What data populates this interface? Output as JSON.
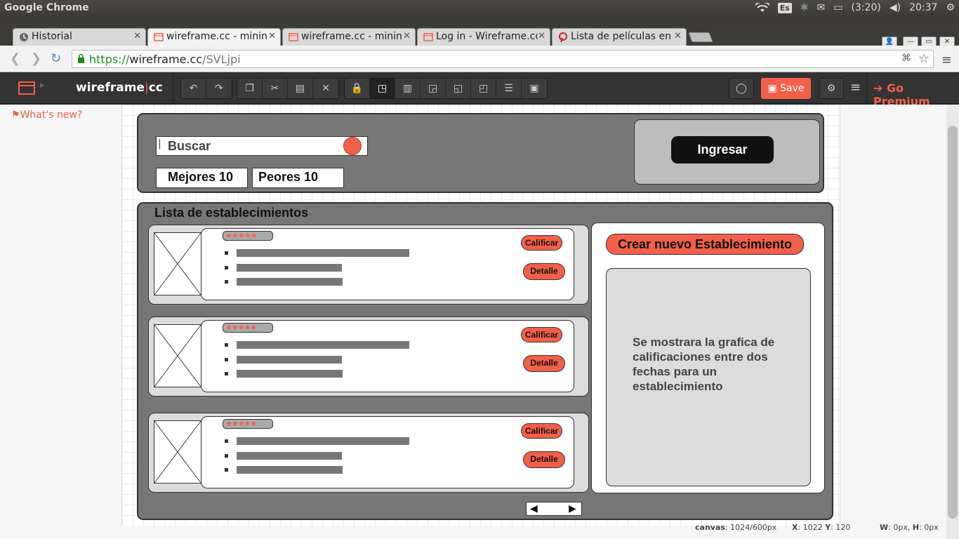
{
  "os": {
    "title": "Google Chrome",
    "lang": "Es",
    "battery": "(3:20)",
    "time": "20:37"
  },
  "tabs": [
    {
      "label": "Historial",
      "icon": "history-icon",
      "active": false
    },
    {
      "label": "wireframe.cc - minin",
      "icon": "wireframe-tab-icon",
      "active": true
    },
    {
      "label": "wireframe.cc - minin",
      "icon": "wireframe-tab-icon",
      "active": false
    },
    {
      "label": "Log in - Wireframe.cc",
      "icon": "wireframe-tab-icon",
      "active": false
    },
    {
      "label": "Lista de películas en",
      "icon": "pinterest-icon",
      "active": false
    }
  ],
  "address": {
    "scheme": "https://",
    "host": "wireframe.cc",
    "path": "/SVLjpi"
  },
  "app": {
    "brand_left": "wireframe",
    "brand_sep": "|",
    "brand_right": "cc",
    "save_label": "Save",
    "premium_label": "Go Premium",
    "whats_new": "What's new?"
  },
  "wireframe": {
    "search_label": "Buscar",
    "best_label": "Mejores 10",
    "worst_label": "Peores 10",
    "login_label": "Ingresar",
    "list_title": "Lista de establecimientos",
    "stars": "★★★★★",
    "rate_label": "Calificar",
    "detail_label": "Detalle",
    "create_label": "Crear nuevo Establecimiento",
    "graph_text": "Se mostrara la grafica de calificaciones entre dos fechas para un establecimiento",
    "pager_prev": "◀",
    "pager_next": "▶"
  },
  "status": {
    "canvas_label": "canvas",
    "canvas_value": ": 1024/600px",
    "x_label": "X",
    "x_value": ": 1022",
    "y_label": "Y",
    "y_value": ": 120",
    "w_label": "W",
    "w_value": ": 0px,",
    "h_label": "H",
    "h_value": ": 0px"
  }
}
